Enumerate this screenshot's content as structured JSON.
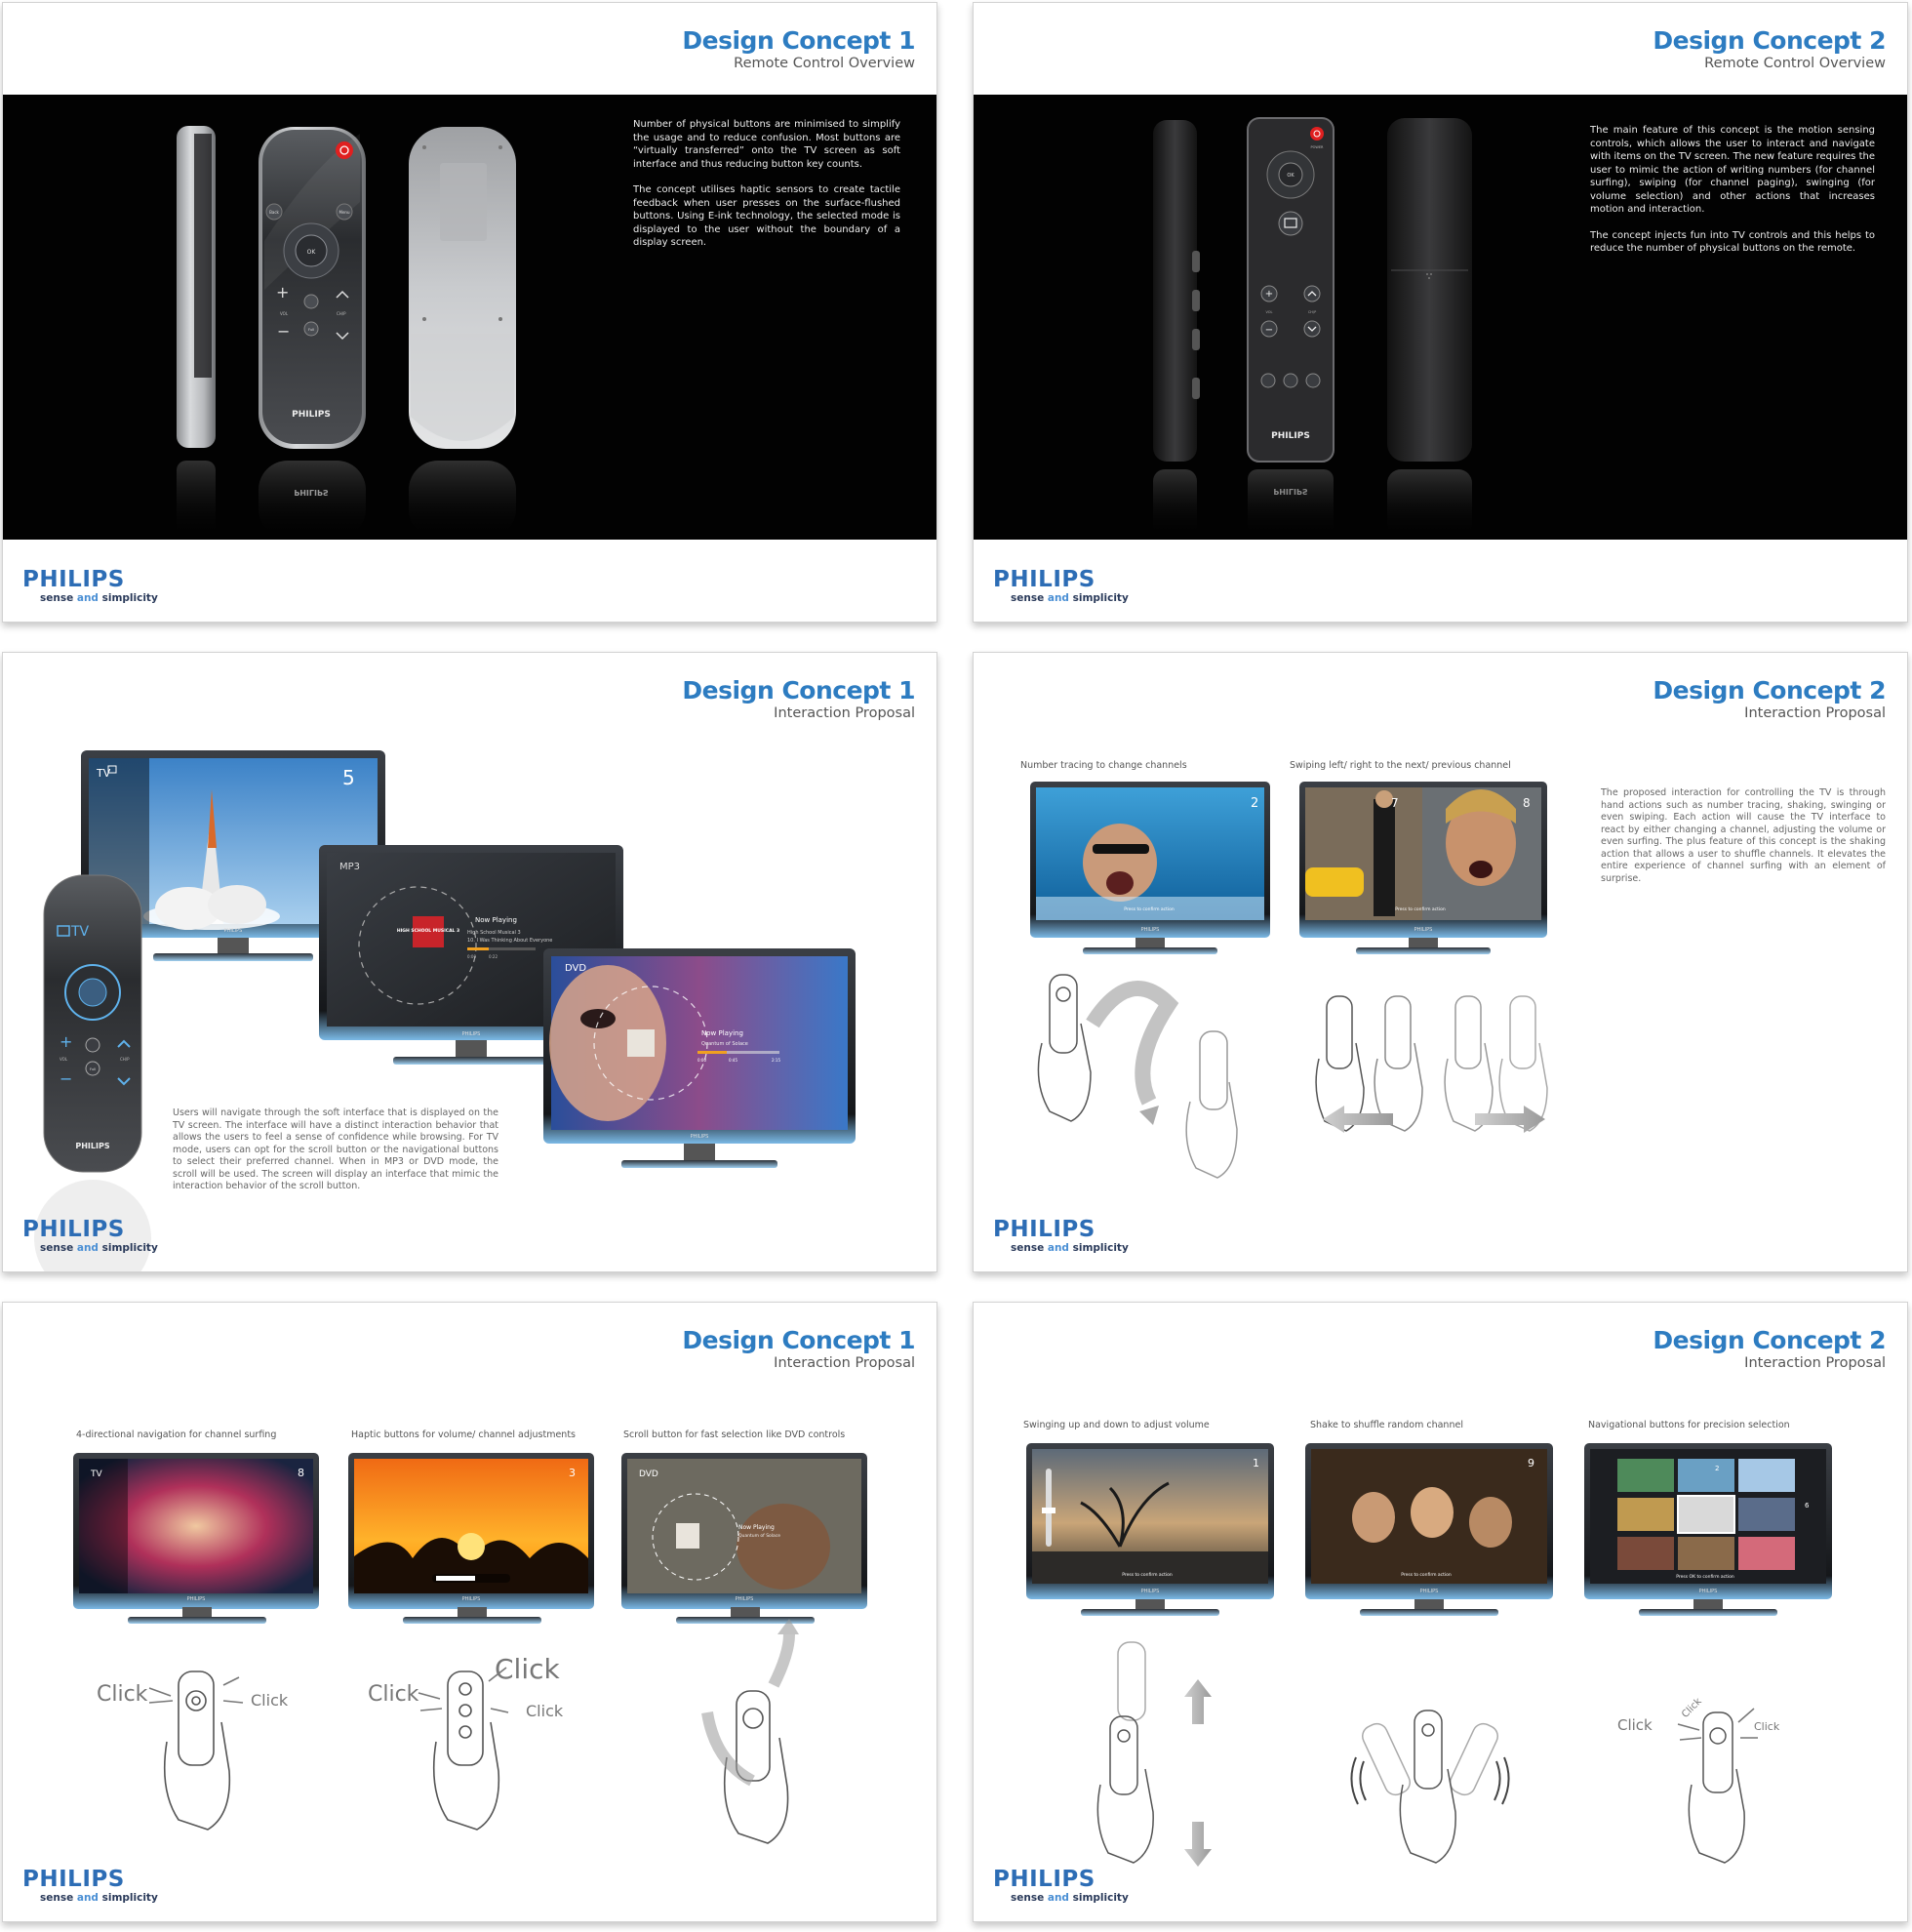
{
  "brand": {
    "logo": "PHILIPS",
    "tag_pre": "sense ",
    "tag_and": "and",
    "tag_post": " simplicity"
  },
  "slides": [
    {
      "title": "Design Concept 1",
      "subtitle": "Remote Control Overview",
      "paragraphs": [
        "Number of physical buttons are minimised to simplify the usage and to reduce confusion. Most buttons are “virtually transferred” onto the TV screen as soft interface and thus reducing button key counts.",
        "The concept utilises haptic sensors to create tactile feedback when user presses on the surface-flushed buttons. Using E-ink technology, the selected mode is displayed to the user without the boundary of a display screen."
      ],
      "remote_labels": {
        "brand": "PHILIPS",
        "ok": "OK",
        "back": "Back",
        "menu": "Menu",
        "vol": "VOL",
        "chup": "CH/P",
        "full": "Full",
        "brand_reflection": "PHILIPS"
      }
    },
    {
      "title": "Design Concept 2",
      "subtitle": "Remote Control Overview",
      "paragraphs": [
        "The main feature of this concept is the motion sensing controls, which allows the user to interact and navigate with items on the TV screen. The new feature requires the user to mimic the action of writing numbers (for channel surfing), swiping (for channel paging), swinging (for volume selection) and other actions that increases motion and interaction.",
        "The concept injects fun into TV controls and this helps to reduce the number of physical buttons on the remote."
      ],
      "remote_labels": {
        "brand": "PHILIPS",
        "power": "POWER",
        "ok": "OK",
        "vol": "VOL",
        "chp": "CH/P",
        "brand_reflection": "PHILIPS"
      }
    },
    {
      "title": "Design Concept 1",
      "subtitle": "Interaction Proposal",
      "paragraph": "Users will navigate through the soft interface that is displayed on the TV screen. The interface will have a distinct interaction behavior that allows the users to feel a sense of confidence while browsing. For TV mode, users can opt for the scroll button or the navigational buttons to select their preferred channel. When in MP3 or DVD mode, the scroll will be used. The screen will display an interface that mimic the interaction behavior of the scroll button.",
      "tv_mode": "TV",
      "tv_channel": "5",
      "mp3_mode": "MP3",
      "mp3_now_playing": "Now Playing",
      "mp3_album": "High School Musical 3",
      "mp3_track": "10. I Was Thinking About Everyone",
      "mp3_time_start": "0:00",
      "mp3_time_end": "0:22",
      "mp3_cover": "HIGH SCHOOL MUSICAL 3",
      "dvd_mode": "DVD",
      "dvd_now_playing": "Now Playing",
      "dvd_title": "Quantum of Solace",
      "dvd_time_start": "0:00",
      "dvd_time_mid": "0:45",
      "dvd_time_end": "2:15",
      "remote_mode": "TV",
      "remote_vol": "VOL",
      "remote_chp": "CH/P",
      "remote_full": "Full",
      "remote_brand": "PHILIPS",
      "tv_brand": "PHILIPS"
    },
    {
      "title": "Design Concept 2",
      "subtitle": "Interaction Proposal",
      "paragraph": "The proposed interaction for controlling the TV is through hand actions such as number tracing, shaking, swinging or even swiping. Each action will cause the TV interface to react by either changing a channel, adjusting the volume or even surfing. The plus feature of this concept is the shaking action that allows a user to shuffle channels. It elevates the entire experience of channel surfing with an element of surprise.",
      "captions": [
        "Number tracing to change channels",
        "Swiping left/ right to the next/ previous channel"
      ],
      "tv1_channel": "2",
      "tv2_channels": [
        "7",
        "8"
      ],
      "confirm_text": "Press  to confirm action",
      "tv_brand": "PHILIPS"
    },
    {
      "title": "Design Concept 1",
      "subtitle": "Interaction Proposal",
      "captions": [
        "4-directional navigation for channel surfing",
        "Haptic buttons for volume/ channel adjustments",
        "Scroll button for fast selection like DVD controls"
      ],
      "tv1_mode": "TV",
      "tv1_channel": "8",
      "tv2_channel": "3",
      "tv3_mode": "DVD",
      "tv3_now_playing": "Now Playing",
      "tv3_title": "Quantum of Solace",
      "click": "Click",
      "tv_brand": "PHILIPS"
    },
    {
      "title": "Design Concept 2",
      "subtitle": "Interaction Proposal",
      "captions": [
        "Swinging up and down to adjust volume",
        "Shake to shuffle random channel",
        "Navigational buttons for precision selection"
      ],
      "tv1_channel": "1",
      "tv2_channel": "9",
      "tv3_channels": [
        "2",
        "6"
      ],
      "confirm_text": "Press  to confirm action",
      "select_text": "Press OK to confirm action",
      "click": "Click",
      "tv_brand": "PHILIPS"
    }
  ],
  "colors": {
    "accent": "#2d7cc1",
    "brand": "#2d6db5",
    "power": "#e02020",
    "screen_blue": "#8fc8ee"
  }
}
